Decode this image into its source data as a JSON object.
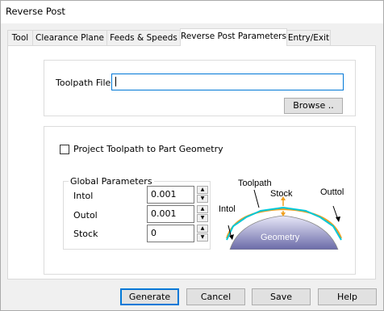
{
  "window": {
    "title": "Reverse Post"
  },
  "tabs": [
    {
      "label": "Tool"
    },
    {
      "label": "Clearance Plane"
    },
    {
      "label": "Feeds & Speeds"
    },
    {
      "label": "Reverse Post Parameters"
    },
    {
      "label": "Entry/Exit"
    }
  ],
  "active_tab": "Reverse Post Parameters",
  "toolpath_file": {
    "label": "Toolpath File",
    "value": ""
  },
  "browse_label": "Browse ..",
  "project_checkbox": {
    "label": "Project Toolpath to Part Geometry",
    "checked": false
  },
  "global_params": {
    "title": "Global Parameters",
    "intol": {
      "label": "Intol",
      "value": "0.001"
    },
    "outol": {
      "label": "Outol",
      "value": "0.001"
    },
    "stock": {
      "label": "Stock",
      "value": "0"
    }
  },
  "diagram": {
    "toolpath": "Toolpath",
    "stock": "Stock",
    "outtol": "Outtol",
    "intol": "Intol",
    "geometry": "Geometry"
  },
  "buttons": {
    "generate": "Generate",
    "cancel": "Cancel",
    "save": "Save",
    "help": "Help"
  },
  "colors": {
    "focus_border": "#0078d7",
    "toolpath_line": "#00c8d8",
    "stock_line": "#f0a020",
    "geometry_top": "#e8e8f8",
    "geometry_bottom": "#6a6aa8"
  }
}
